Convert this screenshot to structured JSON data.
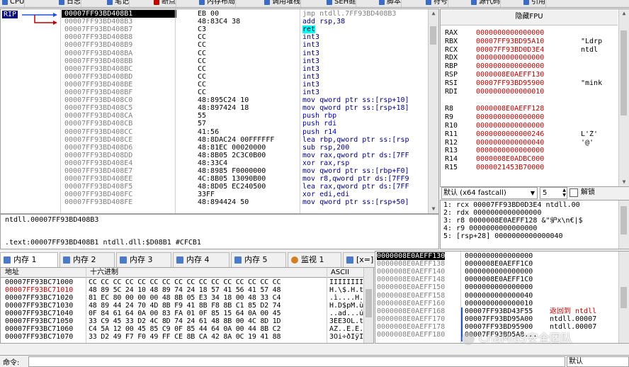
{
  "tabs": [
    {
      "label": "CPU",
      "color": "#3a6bc8"
    },
    {
      "label": "日志",
      "color": "#3a6bc8"
    },
    {
      "label": "笔记",
      "color": "#3a6bc8"
    },
    {
      "label": "断点",
      "color": "#c00000"
    },
    {
      "label": "内存布局",
      "color": "#3a6bc8"
    },
    {
      "label": "调用堆栈",
      "color": "#3a6bc8"
    },
    {
      "label": "SEH链",
      "color": "#3a6bc8"
    },
    {
      "label": "脚本",
      "color": "#3a6bc8"
    },
    {
      "label": "符号",
      "color": "#3a6bc8"
    },
    {
      "label": "源代码",
      "color": "#3a6bc8"
    },
    {
      "label": "引用",
      "color": "#3a6bc8"
    }
  ],
  "disasm": {
    "rip_label": "RIP",
    "rows": [
      {
        "addr": "00007FF93BD408B1",
        "bytes": "EB 00",
        "instr": "jmp ntdll.7FF93BD408B3",
        "current": true
      },
      {
        "addr": "00007FF93BD408B3",
        "bytes": "48:83C4 38",
        "instr": "add rsp,38"
      },
      {
        "addr": "00007FF93BD408B7",
        "bytes": "C3",
        "instr": "ret"
      },
      {
        "addr": "00007FF93BD408B8",
        "bytes": "CC",
        "instr": "int3"
      },
      {
        "addr": "00007FF93BD408B9",
        "bytes": "CC",
        "instr": "int3"
      },
      {
        "addr": "00007FF93BD408BA",
        "bytes": "CC",
        "instr": "int3"
      },
      {
        "addr": "00007FF93BD408BB",
        "bytes": "CC",
        "instr": "int3"
      },
      {
        "addr": "00007FF93BD408BC",
        "bytes": "CC",
        "instr": "int3"
      },
      {
        "addr": "00007FF93BD408BD",
        "bytes": "CC",
        "instr": "int3"
      },
      {
        "addr": "00007FF93BD408BE",
        "bytes": "CC",
        "instr": "int3"
      },
      {
        "addr": "00007FF93BD408BF",
        "bytes": "CC",
        "instr": "int3"
      },
      {
        "addr": "00007FF93BD408C0",
        "bytes": "48:895C24 10",
        "instr": "mov qword ptr ss:[rsp+10]"
      },
      {
        "addr": "00007FF93BD408C5",
        "bytes": "48:897424 18",
        "instr": "mov qword ptr ss:[rsp+18]"
      },
      {
        "addr": "00007FF93BD408CA",
        "bytes": "55",
        "instr": "push rbp"
      },
      {
        "addr": "00007FF93BD408CB",
        "bytes": "57",
        "instr": "push rdi"
      },
      {
        "addr": "00007FF93BD408CC",
        "bytes": "41:56",
        "instr": "push r14"
      },
      {
        "addr": "00007FF93BD408CE",
        "bytes": "48:8DAC24 00FFFFFF",
        "instr": "lea rbp,qword ptr ss:[rsp"
      },
      {
        "addr": "00007FF93BD408D6",
        "bytes": "48:81EC 00020000",
        "instr": "sub rsp,200"
      },
      {
        "addr": "00007FF93BD408DD",
        "bytes": "48:8B05 2C3C0B00",
        "instr": "mov rax,qword ptr ds:[7FF"
      },
      {
        "addr": "00007FF93BD408E4",
        "bytes": "48:33C4",
        "instr": "xor rax,rsp"
      },
      {
        "addr": "00007FF93BD408E7",
        "bytes": "48:8985 F0000000",
        "instr": "mov qword ptr ss:[rbp+F0]"
      },
      {
        "addr": "00007FF93BD408EE",
        "bytes": "4C:8B05 13090B00",
        "instr": "mov r8,qword ptr ds:[7FF9"
      },
      {
        "addr": "00007FF93BD408F5",
        "bytes": "48:8D05 EC240500",
        "instr": "lea rax,qword ptr ds:[7FF"
      },
      {
        "addr": "00007FF93BD408FC",
        "bytes": "33FF",
        "instr": "xor edi,edi"
      },
      {
        "addr": "00007FF93BD408FE",
        "bytes": "48:894424 50",
        "instr": "mov qword ptr ss:[rsp+50]"
      }
    ]
  },
  "info": {
    "line1": "ntdll.00007FF93BD408B3",
    "line2": ".text:00007FF93BD408B1 ntdll.dll:$D08B1 #CFCB1"
  },
  "registers": {
    "header": "隐藏FPU",
    "groups": [
      [
        {
          "name": "RAX",
          "value": "0000000000000000",
          "comment": ""
        },
        {
          "name": "RBX",
          "value": "00007FF93BD95A10",
          "comment": "\"Ldrp"
        },
        {
          "name": "RCX",
          "value": "00007FF93BD0D3E4",
          "comment": "ntdl"
        },
        {
          "name": "RDX",
          "value": "0000000000000000",
          "comment": ""
        },
        {
          "name": "RBP",
          "value": "0000000000000000",
          "comment": ""
        },
        {
          "name": "RSP",
          "value": "0000008E0AEFF130",
          "comment": ""
        },
        {
          "name": "RSI",
          "value": "00007FF93BD95900",
          "comment": "\"mink"
        },
        {
          "name": "RDI",
          "value": "0000000000000010",
          "comment": ""
        }
      ],
      [
        {
          "name": "R8",
          "value": "0000008E0AEFF128",
          "comment": ""
        },
        {
          "name": "R9",
          "value": "0000000000000000",
          "comment": ""
        },
        {
          "name": "R10",
          "value": "0000000000000000",
          "comment": ""
        },
        {
          "name": "R11",
          "value": "0000000000000246",
          "comment": "L'Ž'"
        },
        {
          "name": "R12",
          "value": "0000000000000040",
          "comment": "'@'"
        },
        {
          "name": "R13",
          "value": "0000000000000000",
          "comment": ""
        },
        {
          "name": "R14",
          "value": "0000008E0ADBC000",
          "comment": ""
        },
        {
          "name": "R15",
          "value": "0000021453B70000",
          "comment": ""
        }
      ]
    ]
  },
  "callconv": {
    "select_value": "默认 (x64 fastcall)",
    "count": "5",
    "unlock_label": "解锁",
    "args": [
      "1: rcx 00007FF93BD0D3E4 ntdll.00",
      "2: rdx 0000000000000000",
      "3: r8 0000008E0AEFF128 &\"驴x\\n€|$",
      "4: r9 0000000000000000",
      "5: [rsp+28] 0000000000000040"
    ]
  },
  "memtabs": [
    {
      "label": "内存 1",
      "active": true
    },
    {
      "label": "内存 2"
    },
    {
      "label": "内存 3"
    },
    {
      "label": "内存 4"
    },
    {
      "label": "内存 5"
    },
    {
      "label": "监视 1"
    },
    {
      "label": "[x=] 局部"
    }
  ],
  "dump": {
    "col_addr": "地址",
    "col_hex": "十六进制",
    "col_ascii": "ASCII",
    "rows": [
      {
        "addr": "00007FF93BC71000",
        "hex": "CC CC CC CC CC CC CC CC CC CC CC CC CC CC CC CC",
        "ascii": "ÌÌÌÌÌÌÌÌ"
      },
      {
        "addr": "00007FF93BC71010",
        "hex": "48 89 5C 24 10 48 89 74 24 18 57 41 56 41 57 48",
        "ascii": "H.\\$.H.t"
      },
      {
        "addr": "00007FF93BC71020",
        "hex": "81 EC 80 00 00 00 48 8B 05 E3 34 18 00 48 33 C4",
        "ascii": ".ì....H."
      },
      {
        "addr": "00007FF93BC71030",
        "hex": "48 89 44 24 70 4D 8B F9 41 8B F8 8B C1 85 D2 74",
        "ascii": "H.D$pM.ù"
      },
      {
        "addr": "00007FF93BC71040",
        "hex": "0F 84 61 64 0A 00 83 FA 01 0F 85 15 64 0A 00 45",
        "ascii": "..ad...ú"
      },
      {
        "addr": "00007FF93BC71050",
        "hex": "33 C9 45 33 D2 4C 8D 74 24 61 48 8B 00 4C 8D 1D",
        "ascii": "3ÉE3ÒL.t"
      },
      {
        "addr": "00007FF93BC71060",
        "hex": "C4 5A 12 00 45 85 C9 0F 85 44 64 0A 00 44 8B C2",
        "ascii": "ÄZ..E.É."
      },
      {
        "addr": "00007FF93BC71070",
        "hex": "33 D2 49 F7 F0 49 FF CE 8B CA 42 8A 0C 19 41 88",
        "ascii": "3Òi÷ðIÿÎ"
      }
    ]
  },
  "stack": {
    "rows": [
      {
        "addr": "0000008E0AEFF130",
        "value": "0000000000000000",
        "comment": "",
        "sel": true
      },
      {
        "addr": "0000008E0AEFF138",
        "value": "0000008E0AEFF1C0",
        "comment": ""
      },
      {
        "addr": "0000008E0AEFF140",
        "value": "0000000000000000",
        "comment": ""
      },
      {
        "addr": "0000008E0AEFF148",
        "value": "0000008E0AEFF1C0",
        "comment": ""
      },
      {
        "addr": "0000008E0AEFF150",
        "value": "0000000000000000",
        "comment": ""
      },
      {
        "addr": "0000008E0AEFF158",
        "value": "0000000000000040",
        "comment": ""
      },
      {
        "addr": "0000008E0AEFF160",
        "value": "0000000000000010",
        "comment": ""
      },
      {
        "addr": "0000008E0AEFF168",
        "value": "00007FF93BD43F55",
        "comment": "返回到 ntdll"
      },
      {
        "addr": "0000008E0AEFF170",
        "value": "00007FF93BD95A00",
        "comment": "ntdll.00007"
      },
      {
        "addr": "0000008E0AEFF178",
        "value": "00007FF93BD95900",
        "comment": "ntdll.00007"
      },
      {
        "addr": "0000008E0AEFF180",
        "value": "00007FF93BD5A8...",
        "comment": ""
      }
    ]
  },
  "watermark": "CnaMisS安全团队",
  "command": {
    "label": "命令:",
    "mode": "默认"
  }
}
